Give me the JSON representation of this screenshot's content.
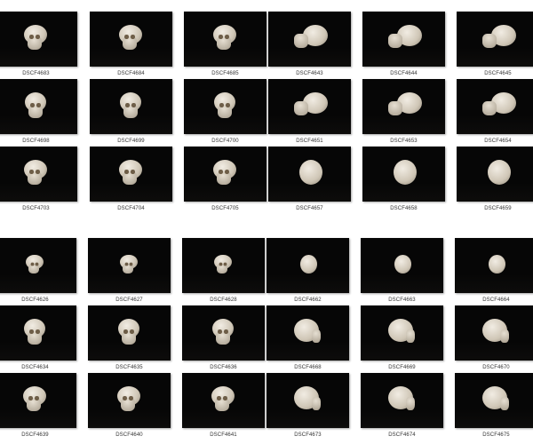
{
  "groups": [
    {
      "rows": [
        [
          "DSCF4683",
          "DSCF4684",
          "DSCF4685",
          "DSCF4643",
          "DSCF4644",
          "DSCF4645"
        ],
        [
          "DSCF4698",
          "DSCF4699",
          "DSCF4700",
          "DSCF4651",
          "DSCF4653",
          "DSCF4654"
        ],
        [
          "DSCF4703",
          "DSCF4704",
          "DSCF4705",
          "DSCF4657",
          "DSCF4658",
          "DSCF4659"
        ]
      ]
    },
    {
      "rows": [
        [
          "DSCF4626",
          "DSCF4627",
          "DSCF4628",
          "DSCF4662",
          "DSCF4663",
          "DSCF4664"
        ],
        [
          "DSCF4634",
          "DSCF4635",
          "DSCF4636",
          "DSCF4668",
          "DSCF4669",
          "DSCF4670"
        ],
        [
          "DSCF4639",
          "DSCF4640",
          "DSCF4641",
          "DSCF4673",
          "DSCF4674",
          "DSCF4675"
        ]
      ]
    }
  ]
}
